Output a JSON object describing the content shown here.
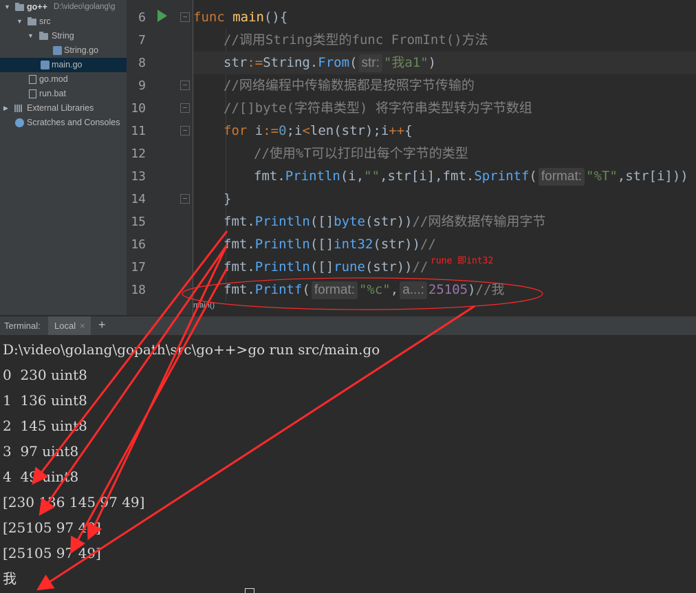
{
  "project": {
    "root": "go++",
    "root_path": "D:\\video\\golang\\g",
    "items": [
      {
        "label": "src"
      },
      {
        "label": "String"
      },
      {
        "label": "String.go"
      },
      {
        "label": "main.go"
      },
      {
        "label": "go.mod"
      },
      {
        "label": "run.bat"
      },
      {
        "label": "External Libraries"
      },
      {
        "label": "Scratches and Consoles"
      }
    ]
  },
  "editor": {
    "line_numbers": [
      "6",
      "7",
      "8",
      "9",
      "10",
      "11",
      "12",
      "13",
      "14",
      "15",
      "16",
      "17",
      "18"
    ],
    "line6": {
      "kw": "func",
      "name": "main",
      "rest": "(){"
    },
    "line7": "//调用String类型的func FromInt()方法",
    "line8": {
      "a": "str",
      "op": ":=",
      "b": "String.",
      "m": "From",
      "p": "(",
      "hint": "str:",
      "s": "\"我a1\"",
      "e": ")"
    },
    "line9": "//网络编程中传输数据都是按照字节传输的",
    "line10": "//[]byte(字符串类型) 将字符串类型转为字节数组",
    "line11": {
      "kw": "for",
      "a": " i",
      "op1": ":=",
      "n": "0",
      "b": ";i",
      "op2": "<",
      "c": "len(str);i",
      "op3": "++",
      "d": "{"
    },
    "line12": "//使用%T可以打印出每个字节的类型",
    "line13": {
      "a": "fmt.",
      "m": "Println",
      "b": "(i,",
      "s": "\"\"",
      "c": ",str[i],fmt.",
      "m2": "Sprintf",
      "p": "(",
      "hint": "format:",
      "s2": "\"%T\"",
      "e": ",str[i]))"
    },
    "line14": "}",
    "line15": {
      "a": "fmt.",
      "m": "Println",
      "b": "([]",
      "t": "byte",
      "c": "(str))",
      "cm": "//网络数据传输用字节"
    },
    "line16": {
      "a": "fmt.",
      "m": "Println",
      "b": "([]",
      "t": "int32",
      "c": "(str))",
      "cm": "//"
    },
    "line17": {
      "a": "fmt.",
      "m": "Println",
      "b": "([]",
      "t": "rune",
      "c": "(str))",
      "cm": "//"
    },
    "line18": {
      "a": "fmt.",
      "m": "Printf",
      "p": "(",
      "hint": "format:",
      "s": "\"%c\"",
      "c1": ",",
      "hint2": "a...:",
      "n": "25105",
      "e": ")",
      "cm": "//我"
    },
    "breadcrumb": "main()",
    "annotation": "rune 即int32"
  },
  "terminal": {
    "label": "Terminal:",
    "tab": "Local",
    "close": "×",
    "add": "+",
    "lines": [
      "D:\\video\\golang\\gopath\\src\\go++>go run src/main.go",
      "0  230 uint8",
      "1  136 uint8",
      "2  145 uint8",
      "3  97 uint8",
      "4  49 uint8",
      "[230 136 145 97 49]",
      "[25105 97 49]",
      "[25105 97 49]",
      "我"
    ]
  },
  "colors": {
    "annotation_red": "#ff2020",
    "keyword": "#cc7832",
    "method": "#56a8f5",
    "comment": "#808080",
    "string": "#6a8759"
  }
}
